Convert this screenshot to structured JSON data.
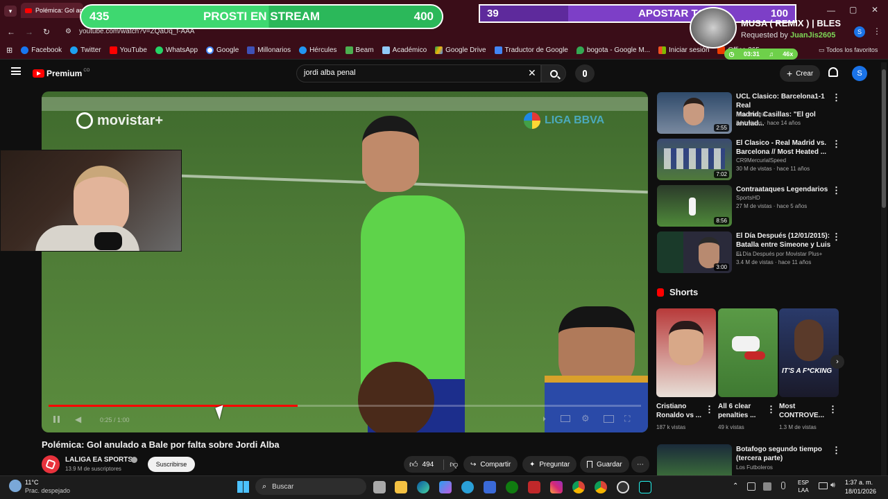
{
  "browser": {
    "tab_title": "Polémica: Gol an",
    "url": "youtube.com/watch?v=ZQaUq_f-AAA",
    "bookmarks": [
      "Facebook",
      "Twitter",
      "YouTube",
      "WhatsApp",
      "Google",
      "Millonarios",
      "Hércules",
      "Beam",
      "Académico",
      "Google Drive",
      "Traductor de Google",
      "bogota - Google M...",
      "Iniciar sesión",
      "Office 365"
    ],
    "all_bookmarks": "Todos los favoritos"
  },
  "overlay": {
    "bar1": {
      "left": "435",
      "label": "PROSTI EN STREAM",
      "right": "400"
    },
    "bar2": {
      "left": "39",
      "label": "APOSTAR TODO",
      "right": "100"
    },
    "song_title": "MUSA ( REMIX ) | BLES",
    "requested_by": "Requested by",
    "requester": "JuanJis2605",
    "timer": "03:31",
    "count": "46x"
  },
  "youtube": {
    "logo": "Premium",
    "logo_sup": "CO",
    "search_value": "jordi alba penal",
    "create": "Crear",
    "avatar": "S",
    "video_title": "Polémica: Gol anulado a Bale por falta sobre Jordi Alba",
    "channel": "LALIGA EA SPORTS",
    "subs": "13.9 M de suscriptores",
    "subscribe": "Suscribirse",
    "likes": "494",
    "share": "Compartir",
    "ask": "Preguntar",
    "save": "Guardar",
    "time": "0:25 / 1:00",
    "progress": 0.42,
    "video_brand": "movistar+",
    "video_league": "LIGA BBVA"
  },
  "recommendations": [
    {
      "title1": "UCL Clasico: Barcelona1-1 Real",
      "title2": "Madrid; Casillas: \"El gol anulad...",
      "channel": "Real Madrid",
      "meta": "84 k vistas · hace 14 años",
      "duration": "2:55"
    },
    {
      "title1": "El Clasico - Real Madrid vs.",
      "title2": "Barcelona // Most Heated ...",
      "channel": "CR9MercurialSpeed",
      "meta": "30 M de vistas · hace 11 años",
      "duration": "7:02"
    },
    {
      "title1": "Contraataques Legendarios",
      "title2": "",
      "channel": "SportsHD",
      "meta": "27 M de vistas · hace 5 años",
      "duration": "8:56"
    },
    {
      "title1": "El Día Después (12/01/2015):",
      "title2": "Batalla entre Simeone y Luis ...",
      "channel": "El Día Después por Movistar Plus+",
      "meta": "3.4 M de vistas · hace 11 años",
      "duration": "3:00"
    }
  ],
  "shorts": {
    "header": "Shorts",
    "items": [
      {
        "title1": "Cristiano",
        "title2": "Ronaldo vs ...",
        "views": "187 k vistas"
      },
      {
        "title1": "All 6 clear",
        "title2": "penalties ...",
        "views": "49 k vistas"
      },
      {
        "title1": "Most",
        "title2": "CONTROVE...",
        "views": "1.3 M de vistas"
      }
    ],
    "short3_caption": "IT'S A F*CKING"
  },
  "next_rec": {
    "title1": "Botafogo segundo tiempo",
    "title2": "(tercera parte)",
    "channel": "Los Futboleros"
  },
  "taskbar": {
    "weather_temp": "11°C",
    "weather_desc": "Prac. despejado",
    "search": "Buscar",
    "lang1": "ESP",
    "lang2": "LAA",
    "time": "1:37 a. m.",
    "date": "18/01/2026"
  }
}
